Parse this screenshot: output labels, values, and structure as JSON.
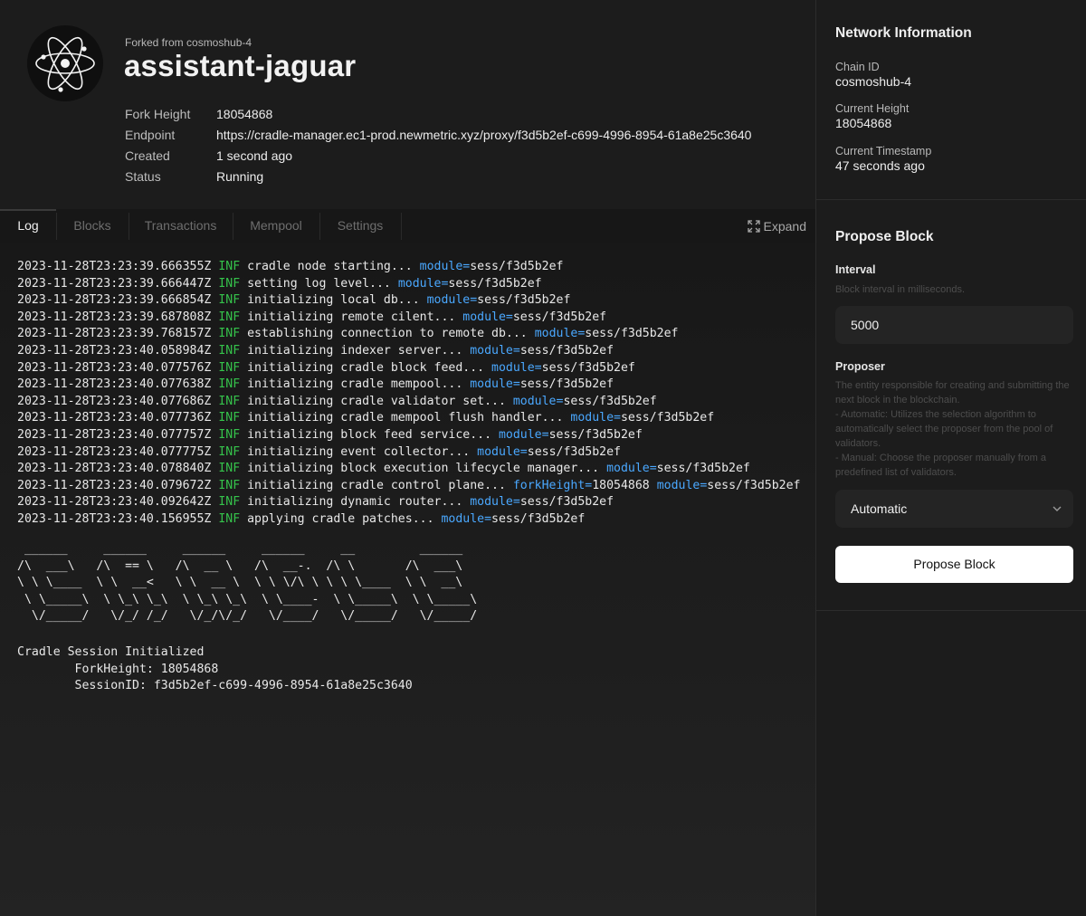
{
  "header": {
    "forked_from": "Forked from cosmoshub-4",
    "title": "assistant-jaguar",
    "meta": [
      {
        "key": "Fork Height",
        "value": "18054868"
      },
      {
        "key": "Endpoint",
        "value": "https://cradle-manager.ec1-prod.newmetric.xyz/proxy/f3d5b2ef-c699-4996-8954-61a8e25c3640"
      },
      {
        "key": "Created",
        "value": "1 second ago"
      },
      {
        "key": "Status",
        "value": "Running"
      }
    ]
  },
  "tabs": [
    {
      "label": "Log",
      "active": true
    },
    {
      "label": "Blocks",
      "active": false
    },
    {
      "label": "Transactions",
      "active": false
    },
    {
      "label": "Mempool",
      "active": false
    },
    {
      "label": "Settings",
      "active": false
    }
  ],
  "expand_label": "Expand",
  "log": {
    "level": "INF",
    "lines": [
      {
        "ts": "2023-11-28T23:23:39.666355Z",
        "msg": "cradle node starting...",
        "fields": [
          {
            "k": "module",
            "v": "sess/f3d5b2ef"
          }
        ]
      },
      {
        "ts": "2023-11-28T23:23:39.666447Z",
        "msg": "setting log level...",
        "fields": [
          {
            "k": "module",
            "v": "sess/f3d5b2ef"
          }
        ]
      },
      {
        "ts": "2023-11-28T23:23:39.666854Z",
        "msg": "initializing local db...",
        "fields": [
          {
            "k": "module",
            "v": "sess/f3d5b2ef"
          }
        ]
      },
      {
        "ts": "2023-11-28T23:23:39.687808Z",
        "msg": "initializing remote cilent...",
        "fields": [
          {
            "k": "module",
            "v": "sess/f3d5b2ef"
          }
        ]
      },
      {
        "ts": "2023-11-28T23:23:39.768157Z",
        "msg": "establishing connection to remote db...",
        "fields": [
          {
            "k": "module",
            "v": "sess/f3d5b2ef"
          }
        ]
      },
      {
        "ts": "2023-11-28T23:23:40.058984Z",
        "msg": "initializing indexer server...",
        "fields": [
          {
            "k": "module",
            "v": "sess/f3d5b2ef"
          }
        ]
      },
      {
        "ts": "2023-11-28T23:23:40.077576Z",
        "msg": "initializing cradle block feed...",
        "fields": [
          {
            "k": "module",
            "v": "sess/f3d5b2ef"
          }
        ]
      },
      {
        "ts": "2023-11-28T23:23:40.077638Z",
        "msg": "initializing cradle mempool...",
        "fields": [
          {
            "k": "module",
            "v": "sess/f3d5b2ef"
          }
        ]
      },
      {
        "ts": "2023-11-28T23:23:40.077686Z",
        "msg": "initializing cradle validator set...",
        "fields": [
          {
            "k": "module",
            "v": "sess/f3d5b2ef"
          }
        ]
      },
      {
        "ts": "2023-11-28T23:23:40.077736Z",
        "msg": "initializing cradle mempool flush handler...",
        "fields": [
          {
            "k": "module",
            "v": "sess/f3d5b2ef"
          }
        ]
      },
      {
        "ts": "2023-11-28T23:23:40.077757Z",
        "msg": "initializing block feed service...",
        "fields": [
          {
            "k": "module",
            "v": "sess/f3d5b2ef"
          }
        ]
      },
      {
        "ts": "2023-11-28T23:23:40.077775Z",
        "msg": "initializing event collector...",
        "fields": [
          {
            "k": "module",
            "v": "sess/f3d5b2ef"
          }
        ]
      },
      {
        "ts": "2023-11-28T23:23:40.078840Z",
        "msg": "initializing block execution lifecycle manager...",
        "fields": [
          {
            "k": "module",
            "v": "sess/f3d5b2ef"
          }
        ]
      },
      {
        "ts": "2023-11-28T23:23:40.079672Z",
        "msg": "initializing cradle control plane...",
        "fields": [
          {
            "k": "forkHeight",
            "v": "18054868"
          },
          {
            "k": "module",
            "v": "sess/f3d5b2ef"
          }
        ]
      },
      {
        "ts": "2023-11-28T23:23:40.092642Z",
        "msg": "initializing dynamic router...",
        "fields": [
          {
            "k": "module",
            "v": "sess/f3d5b2ef"
          }
        ]
      },
      {
        "ts": "2023-11-28T23:23:40.156955Z",
        "msg": "applying cradle patches...",
        "fields": [
          {
            "k": "module",
            "v": "sess/f3d5b2ef"
          }
        ]
      }
    ],
    "ascii_art": " ______     ______     ______     ______     __         ______    \n/\\  ___\\   /\\  == \\   /\\  __ \\   /\\  __-.  /\\ \\       /\\  ___\\   \n\\ \\ \\____  \\ \\  __<   \\ \\  __ \\  \\ \\ \\/\\ \\ \\ \\ \\____  \\ \\  __\\   \n \\ \\_____\\  \\ \\_\\ \\_\\  \\ \\_\\ \\_\\  \\ \\____-  \\ \\_____\\  \\ \\_____\\ \n  \\/_____/   \\/_/ /_/   \\/_/\\/_/   \\/____/   \\/_____/   \\/_____/ ",
    "session_title": "Cradle Session Initialized",
    "session_fork_height": "        ForkHeight: 18054868",
    "session_id": "        SessionID: f3d5b2ef-c699-4996-8954-61a8e25c3640"
  },
  "network": {
    "heading": "Network Information",
    "chain_id_label": "Chain ID",
    "chain_id": "cosmoshub-4",
    "height_label": "Current Height",
    "height": "18054868",
    "timestamp_label": "Current Timestamp",
    "timestamp": "47 seconds ago"
  },
  "propose": {
    "heading": "Propose Block",
    "interval_label": "Interval",
    "interval_help": "Block interval in milliseconds.",
    "interval_value": "5000",
    "proposer_label": "Proposer",
    "proposer_help": [
      "The entity responsible for creating and submitting the next block in the blockchain.",
      "- Automatic: Utilizes the selection algorithm to automatically select the proposer from the pool of validators.",
      "- Manual: Choose the proposer manually from a predefined list of validators."
    ],
    "proposer_value": "Automatic",
    "button_label": "Propose Block"
  },
  "colors": {
    "background": "#1c1c1c",
    "log_level": "#35c24b",
    "log_key": "#4aa8ff",
    "button_bg": "#ffffff"
  }
}
